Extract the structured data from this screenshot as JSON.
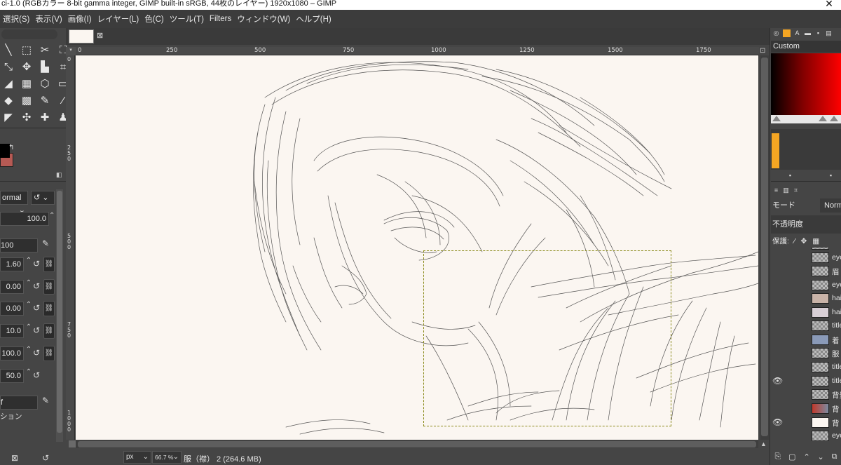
{
  "window": {
    "title": "ci-1.0 (RGBカラー 8-bit gamma integer, GIMP built-in sRGB, 44枚のレイヤー) 1920x1080 – GIMP",
    "close_glyph": "✕"
  },
  "menu": [
    {
      "label": "選択(S)"
    },
    {
      "label": "表示(V)"
    },
    {
      "label": "画像(I)"
    },
    {
      "label": "レイヤー(L)"
    },
    {
      "label": "色(C)"
    },
    {
      "label": "ツール(T)"
    },
    {
      "label": "Filters"
    },
    {
      "label": "ウィンドウ(W)"
    },
    {
      "label": "ヘルプ(H)"
    }
  ],
  "tool_options": {
    "mode": "ormal",
    "opacity": "100.0",
    "brush_value": "100",
    "size": "1.60",
    "aspect": "0.00",
    "angle": "0.00",
    "spacing": "10.0",
    "hardness": "100.0",
    "force": "50.0",
    "dynamics": "f",
    "dynamics_options": "ション"
  },
  "image_tab": {
    "close_glyph": "⊠"
  },
  "ruler": {
    "top_labels": [
      "0",
      "250",
      "500",
      "750",
      "1000",
      "1250",
      "1500",
      "1750"
    ],
    "left_labels": [
      "0",
      "250",
      "500",
      "750",
      "1000"
    ]
  },
  "status": {
    "unit": "px",
    "zoom": "66.7 %",
    "layer_info": "服（襟） 2 (264.6 MB)"
  },
  "colors_dock": {
    "mode": "Custom"
  },
  "layers_dock": {
    "mode_label": "モード",
    "mode_value": "Norm",
    "opacity_label": "不透明度",
    "protect_label": "保護:",
    "layers": [
      {
        "name": "",
        "visible": false
      },
      {
        "name": "eye",
        "visible": false
      },
      {
        "name": "眉",
        "visible": false
      },
      {
        "name": "eye",
        "visible": false
      },
      {
        "name": "hai",
        "visible": false
      },
      {
        "name": "hai",
        "visible": false
      },
      {
        "name": "title",
        "visible": false
      },
      {
        "name": "着",
        "visible": false
      },
      {
        "name": "服",
        "visible": false
      },
      {
        "name": "title",
        "visible": false
      },
      {
        "name": "title",
        "visible": true
      },
      {
        "name": "背景",
        "visible": false
      },
      {
        "name": "背",
        "visible": false
      },
      {
        "name": "背",
        "visible": true
      },
      {
        "name": "eye",
        "visible": false
      }
    ]
  },
  "accent_colors": {
    "background_swatch": "#b65a54",
    "canvas_bg": "#fbf6f1",
    "fg_color_bar": "#f5a623"
  }
}
